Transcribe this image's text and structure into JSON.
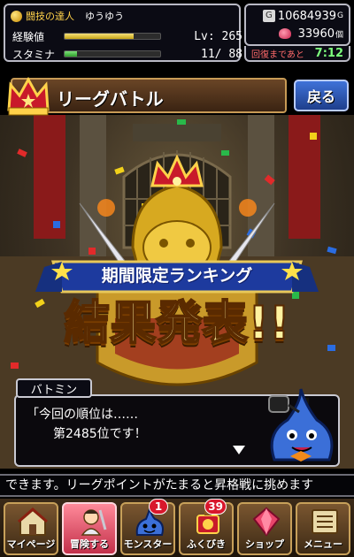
{
  "status": {
    "title": "闘技の達人",
    "player_name": "ゆうゆう",
    "exp_label": "経験値",
    "exp_progress": 0.72,
    "level_text": "Lv: 265",
    "stamina_label": "スタミナ",
    "stamina_progress": 0.125,
    "stamina_text": "11/  88"
  },
  "currency": {
    "gold_symbol": "G",
    "gold": "10684939",
    "gold_unit": "G",
    "gems": "33960",
    "gems_unit": "個"
  },
  "recovery": {
    "label": "回復まであと",
    "time": "7:12"
  },
  "header": {
    "title": "リーグバトル",
    "back_label": "戻る"
  },
  "announcement": {
    "banner": "期間限定ランキング",
    "result": "結果発表!!"
  },
  "dialog": {
    "speaker": "バトミン",
    "line1": "「今回の順位は……",
    "line2": "第2485位です！"
  },
  "ticker": {
    "text": "できます。リーグポイントがたまると昇格戦に挑めます"
  },
  "nav": {
    "items": [
      {
        "label": "マイページ",
        "icon": "house-icon",
        "badge": ""
      },
      {
        "label": "冒険する",
        "icon": "adventure-icon",
        "badge": ""
      },
      {
        "label": "モンスター",
        "icon": "slime-icon",
        "badge": "1"
      },
      {
        "label": "ふくびき",
        "icon": "lottery-icon",
        "badge": "39"
      },
      {
        "label": "ショップ",
        "icon": "gem-icon",
        "badge": ""
      },
      {
        "label": "メニュー",
        "icon": "menu-icon",
        "badge": ""
      }
    ]
  },
  "colors": {
    "gold_accent": "#ffd24a",
    "recovery_time": "#7dff7d",
    "back_button": "#3f72d8",
    "active_nav": "#c3304a"
  }
}
